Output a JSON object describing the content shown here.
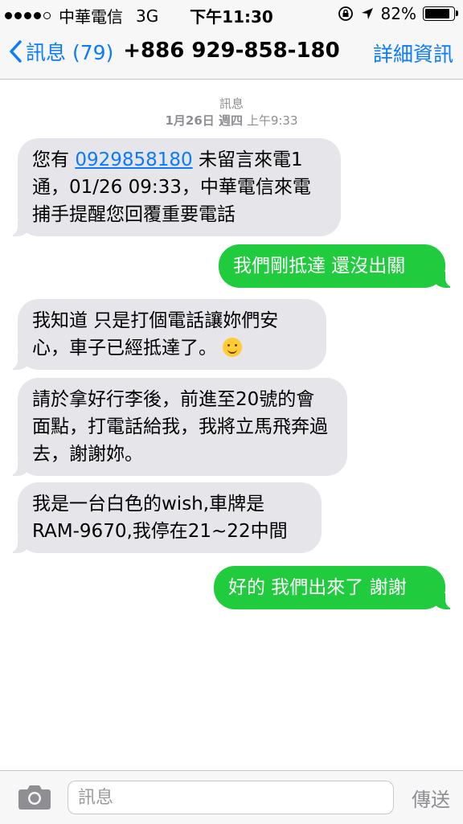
{
  "status_bar": {
    "carrier": "中華電信",
    "network": "3G",
    "time": "下午11:30",
    "battery": "82%",
    "battery_level": 0.82
  },
  "nav": {
    "back_label": "訊息 (79)",
    "title": "+886 929-858-180",
    "details_label": "詳細資訊"
  },
  "timestamp": {
    "label": "訊息",
    "date": "1月26日 週四",
    "time": "上午9:33"
  },
  "messages": [
    {
      "from": "them",
      "pre": "您有 ",
      "link": "0929858180",
      "post": " 未留言來電1通，01/26 09:33，中華電信來電捕手提醒您回覆重要電話"
    },
    {
      "from": "me",
      "text": "我們剛抵達 還沒出關"
    },
    {
      "from": "them",
      "text": "我知道 只是打個電話讓妳們安心，車子已經抵達了。"
    },
    {
      "from": "them",
      "text": "請於拿好行李後，前進至20號的會面點，打電話給我，我將立馬飛奔過去，謝謝妳。"
    },
    {
      "from": "them",
      "text": "我是一台白色的wish,車牌是RAM-9670,我停在21~22中間"
    },
    {
      "from": "me",
      "text": "好的 我們出來了 謝謝"
    }
  ],
  "input": {
    "placeholder": "訊息",
    "send_label": "傳送"
  },
  "colors": {
    "accent": "#0a7aff",
    "outgoing_bubble": "#20cc3e",
    "incoming_bubble": "#e5e5ea"
  }
}
